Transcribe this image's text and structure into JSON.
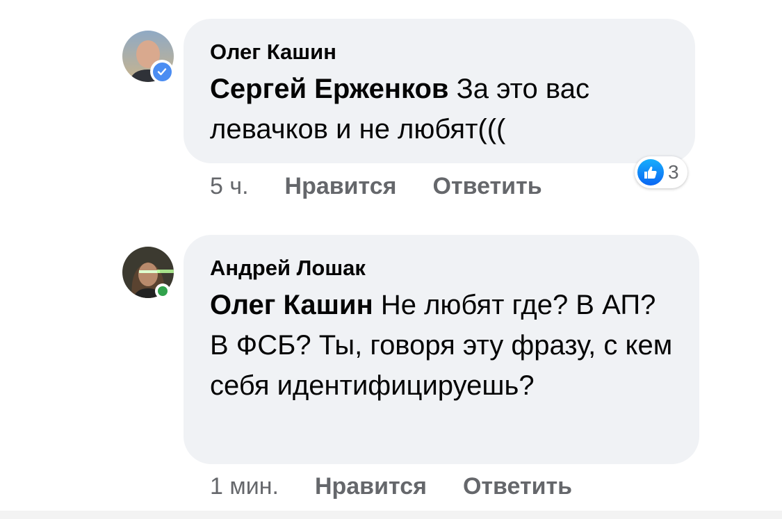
{
  "comments": [
    {
      "author": "Олег Кашин",
      "mention": "Сергей Ерженков",
      "text": " За это вас левачков и не любят(((",
      "time": "5 ч.",
      "like_label": "Нравится",
      "reply_label": "Ответить",
      "reaction_count": "3",
      "verified": true
    },
    {
      "author": "Андрей Лошак",
      "mention": "Олег Кашин",
      "text": " Не любят где? В АП? В ФСБ? Ты, говоря эту фразу,  с кем себя идентифицируешь?",
      "time": "1 мин.",
      "like_label": "Нравится",
      "reply_label": "Ответить",
      "online": true
    }
  ],
  "colors": {
    "bubble": "#f0f2f5",
    "meta_text": "#65676b",
    "verified_badge": "#4b8df2",
    "online_dot": "#31a24c",
    "like_reaction": "#0a66f3"
  },
  "icons": {
    "verified": "verified-check-icon",
    "like": "like-thumb-icon",
    "online": "online-status-icon"
  }
}
